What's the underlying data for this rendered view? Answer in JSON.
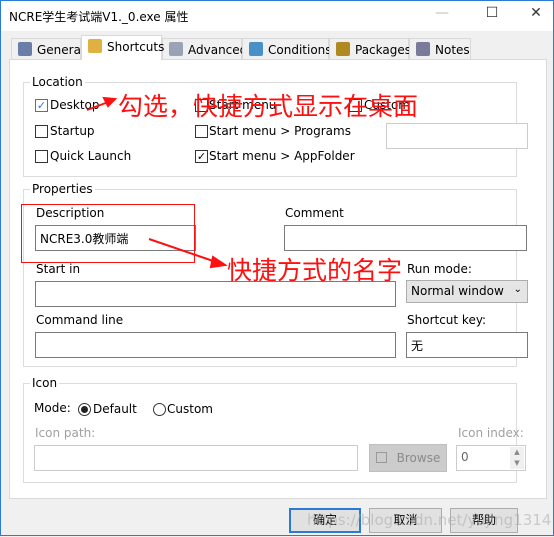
{
  "window": {
    "title": "NCRE学生考试端V1._0.exe 属性",
    "minimize": "—",
    "maximize": "☐",
    "close": "✕"
  },
  "tabs": [
    {
      "label": "General",
      "icon": "list-icon",
      "color": "#6a7fa8"
    },
    {
      "label": "Shortcuts",
      "icon": "folder-shortcut-icon",
      "color": "#e0b040",
      "selected": true
    },
    {
      "label": "Advanced",
      "icon": "document-icon",
      "color": "#9aa3b5"
    },
    {
      "label": "Conditions",
      "icon": "checklist-icon",
      "color": "#4a90c8"
    },
    {
      "label": "Packages",
      "icon": "package-icon",
      "color": "#b08a20"
    },
    {
      "label": "Notes",
      "icon": "notepad-pencil-icon",
      "color": "#7a7a9a"
    }
  ],
  "location": {
    "legend": "Location",
    "desktop": {
      "label": "Desktop",
      "checked": true
    },
    "startup": {
      "label": "Startup",
      "checked": false
    },
    "quick_launch": {
      "label": "Quick Launch",
      "checked": false
    },
    "start_menu": {
      "label": "Start menu",
      "checked": false
    },
    "start_menu_programs": {
      "label": "Start menu > Programs",
      "checked": false
    },
    "start_menu_appfolder": {
      "label": "Start menu > AppFolder",
      "checked": true
    },
    "custom": {
      "label": "Custom",
      "checked": false
    },
    "custom_value": ""
  },
  "properties": {
    "legend": "Properties",
    "description_label": "Description",
    "description_value": "NCRE3.0教师端",
    "comment_label": "Comment",
    "comment_value": "",
    "start_in_label": "Start in",
    "start_in_value": "",
    "run_mode_label": "Run mode:",
    "run_mode_value": "Normal window",
    "command_line_label": "Command line",
    "command_line_value": "",
    "shortcut_key_label": "Shortcut key:",
    "shortcut_key_value": "无"
  },
  "icon": {
    "legend": "Icon",
    "mode_label": "Mode:",
    "default_label": "Default",
    "custom_label": "Custom",
    "mode": "Default",
    "path_label": "Icon path:",
    "path_value": "",
    "browse_label": "Browse",
    "index_label": "Icon index:",
    "index_value": "0"
  },
  "buttons": {
    "ok": "确定",
    "cancel": "取消",
    "help": "帮助"
  },
  "annotations": {
    "note1": "勾选，快捷方式显示在桌面",
    "note2": "快捷方式的名字",
    "color": "#ff1010"
  },
  "watermark": "https://blog.csdn.net/yujing1314"
}
